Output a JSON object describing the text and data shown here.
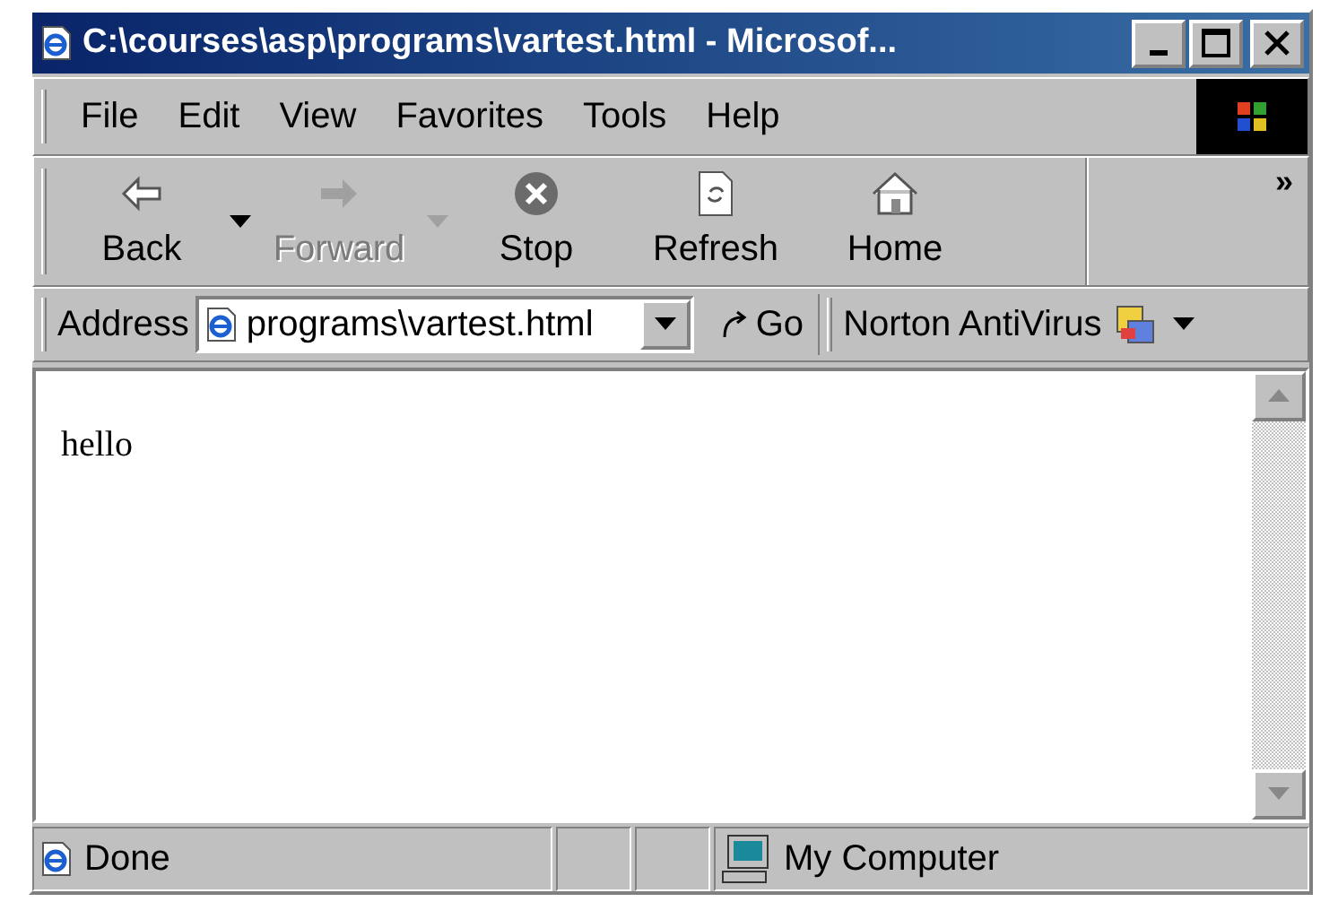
{
  "window": {
    "title": "C:\\courses\\asp\\programs\\vartest.html - Microsof..."
  },
  "menu": [
    "File",
    "Edit",
    "View",
    "Favorites",
    "Tools",
    "Help"
  ],
  "toolbar": {
    "buttons": [
      {
        "kind": "back",
        "label": "Back",
        "disabled": false,
        "dropdown": true
      },
      {
        "kind": "forward",
        "label": "Forward",
        "disabled": true,
        "dropdown": true
      },
      {
        "kind": "stop",
        "label": "Stop",
        "disabled": false,
        "dropdown": false
      },
      {
        "kind": "refresh",
        "label": "Refresh",
        "disabled": false,
        "dropdown": false
      },
      {
        "kind": "home",
        "label": "Home",
        "disabled": false,
        "dropdown": false
      }
    ],
    "more": "»"
  },
  "address_bar": {
    "label": "Address",
    "value": "programs\\vartest.html",
    "go": "Go",
    "links": "Norton AntiVirus"
  },
  "content": {
    "text": "hello"
  },
  "status_bar": {
    "text": "Done",
    "zone": "My Computer"
  }
}
